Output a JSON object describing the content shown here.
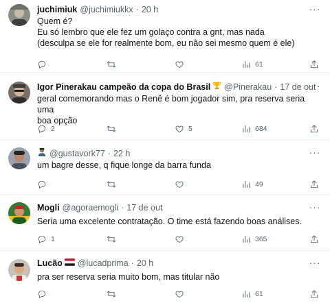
{
  "colors": {
    "text": "#0f1419",
    "secondary": "#536471",
    "divider": "#eff3f4"
  },
  "icons": {
    "more": "more-icon",
    "reply": "reply-icon",
    "retweet": "retweet-icon",
    "like": "like-icon",
    "views": "views-icon",
    "share": "share-icon"
  },
  "tweets": [
    {
      "name": "juchimiuk",
      "handle": "@juchimiukkx",
      "dot": "·",
      "time": "20 h",
      "lines": [
        "Quem é?",
        "Eu só lembro que ele fez um golaço contra a gnt, mas nada",
        "(desculpa se ele for realmente bom, eu não sei mesmo quem é ele)"
      ],
      "replies": "",
      "retweets": "",
      "likes": "",
      "views": "61"
    },
    {
      "name": "Igor Pinerakau campeão da copa do Brasil",
      "badge": "trophy-emoji",
      "handle": "@Pinerakau",
      "dot": "·",
      "time": "17 de out",
      "lines": [
        "geral comemorando mas o Renê é bom jogador sim, pra reserva seria uma",
        "boa opção"
      ],
      "replies": "2",
      "retweets": "",
      "likes": "5",
      "views": "684"
    },
    {
      "name": "",
      "badge": "person-emoji",
      "handle": "@gustavork77",
      "dot": "·",
      "time": "22 h",
      "lines": [
        "um bagre desse, q fique longe da barra funda"
      ],
      "replies": "",
      "retweets": "",
      "likes": "",
      "views": "49"
    },
    {
      "name": "Mogli",
      "handle": "@agoraemogli",
      "dot": "·",
      "time": "17 de out",
      "lines": [
        "Seria uma excelente contratação. O time está fazendo boas análises."
      ],
      "replies": "1",
      "retweets": "",
      "likes": "",
      "views": "365"
    },
    {
      "name": "Lucão",
      "badge": "flag-emoji",
      "handle": "@lucadprima",
      "dot": "·",
      "time": "20 h",
      "lines": [
        "pra ser reserva seria muito bom, mas titular não"
      ],
      "replies": "",
      "retweets": "",
      "likes": "",
      "views": "61"
    }
  ]
}
